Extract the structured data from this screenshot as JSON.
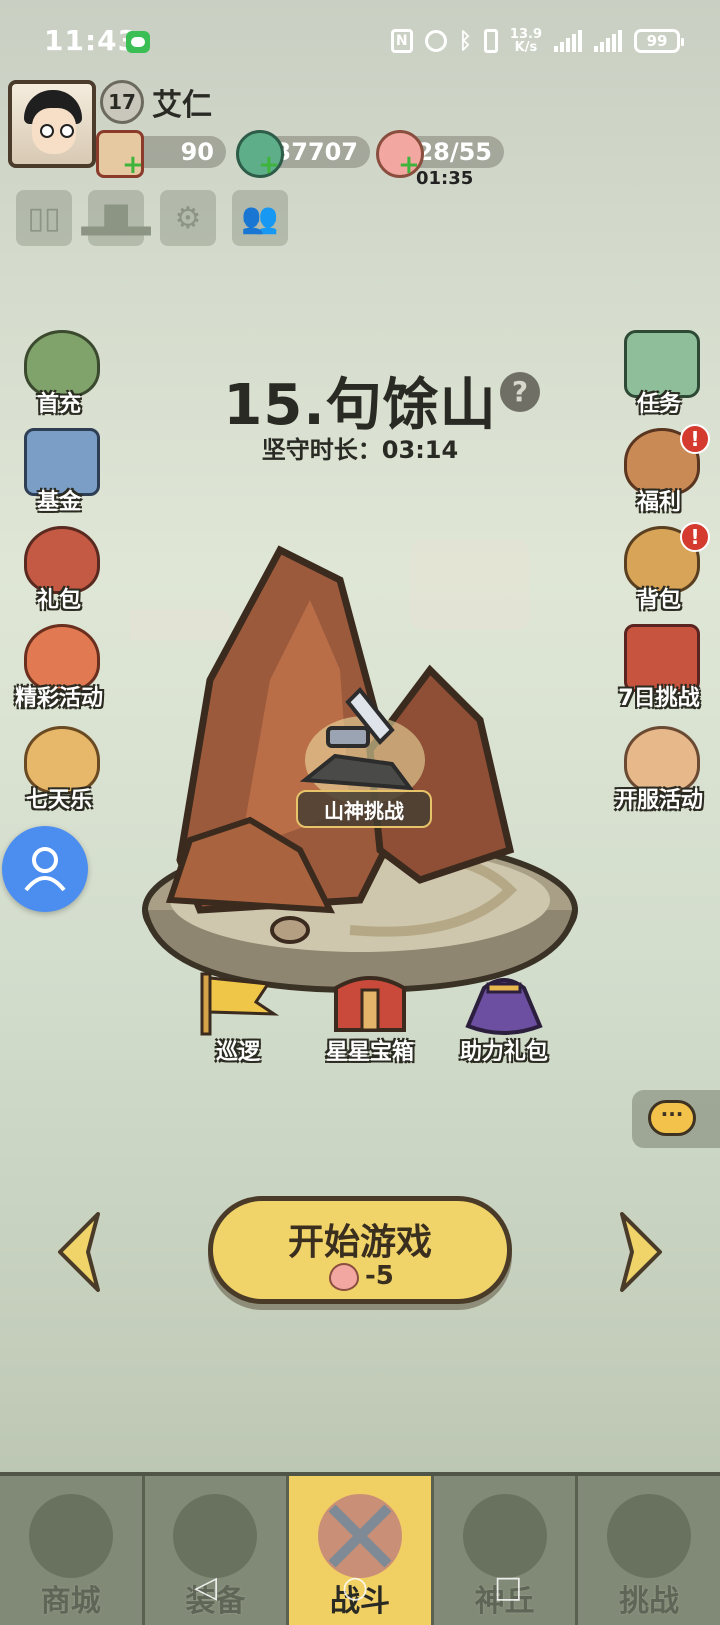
{
  "status_bar": {
    "time": "11:43",
    "network_speed_value": "13.9",
    "network_speed_unit": "K/s",
    "battery": "99"
  },
  "player": {
    "level": "17",
    "name": "艾仁"
  },
  "resources": {
    "scrolls": "90",
    "jade": "37707",
    "stamina": "28/55",
    "stamina_timer": "01:35"
  },
  "stage": {
    "title": "15.句馀山",
    "guard_label": "坚守时长：03:14",
    "boss_label": "山神挑战"
  },
  "left_menu": [
    {
      "label": "首充",
      "icon": "first-recharge-icon"
    },
    {
      "label": "基金",
      "icon": "fund-icon"
    },
    {
      "label": "礼包",
      "icon": "gift-pack-icon"
    },
    {
      "label": "精彩活动",
      "icon": "events-icon"
    },
    {
      "label": "七天乐",
      "icon": "seven-days-icon"
    }
  ],
  "right_menu": [
    {
      "label": "任务",
      "icon": "quest-scroll-icon",
      "alert": false
    },
    {
      "label": "福利",
      "icon": "welfare-bag-icon",
      "alert": true
    },
    {
      "label": "背包",
      "icon": "backpack-icon",
      "alert": true
    },
    {
      "label": "7日挑战",
      "icon": "seven-day-challenge-icon",
      "alert": false
    },
    {
      "label": "开服活动",
      "icon": "server-launch-icon",
      "alert": false
    }
  ],
  "stage_items": [
    {
      "label": "巡逻",
      "icon": "patrol-flag-icon"
    },
    {
      "label": "星星宝箱",
      "icon": "star-chest-icon"
    },
    {
      "label": "助力礼包",
      "icon": "boost-gift-bag-icon"
    }
  ],
  "start": {
    "label": "开始游戏",
    "cost": "-5"
  },
  "bottom_nav": [
    {
      "label": "商城",
      "icon": "shop-icon",
      "active": false
    },
    {
      "label": "装备",
      "icon": "equipment-helmet-icon",
      "active": false
    },
    {
      "label": "战斗",
      "icon": "battle-swords-icon",
      "active": true
    },
    {
      "label": "神丘",
      "icon": "sacred-hill-icon",
      "active": false
    },
    {
      "label": "挑战",
      "icon": "challenge-icon",
      "active": false
    }
  ],
  "colors": {
    "accent_yellow": "#f0cf63",
    "alert_red": "#d43b2e",
    "plus_green": "#3fb43c",
    "float_blue": "#4c8df0"
  }
}
